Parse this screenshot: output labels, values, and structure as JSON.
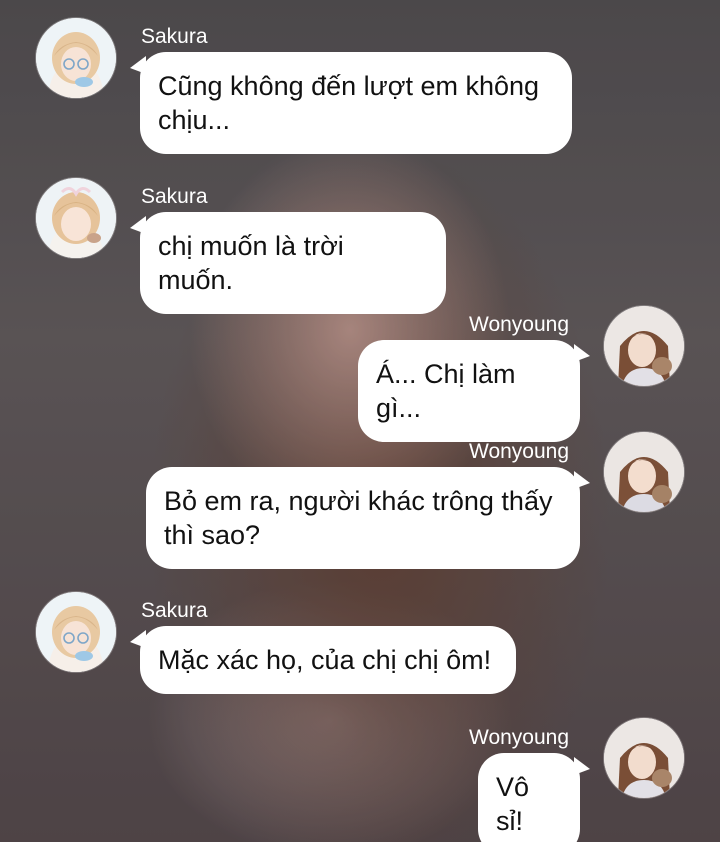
{
  "messages": [
    {
      "sender": "Sakura",
      "side": "left",
      "text": "Cũng không đến lượt em không chịu..."
    },
    {
      "sender": "Sakura",
      "side": "left",
      "text": "chị muốn là trời muốn."
    },
    {
      "sender": "Wonyoung",
      "side": "right",
      "text": "Á... Chị làm gì..."
    },
    {
      "sender": "Wonyoung",
      "side": "right",
      "text": "Bỏ em ra, người khác trông thấy thì sao?"
    },
    {
      "sender": "Sakura",
      "side": "left",
      "text": "Mặc xác họ, của chị chị ôm!"
    },
    {
      "sender": "Wonyoung",
      "side": "right",
      "text": "Vô sỉ!"
    }
  ],
  "avatars": {
    "sakura_icon": "sakura-avatar-icon",
    "wonyoung_icon": "wonyoung-avatar-icon"
  },
  "colors": {
    "bubble": "#ffffff",
    "name_text": "#ffffff",
    "message_text": "#111111"
  }
}
